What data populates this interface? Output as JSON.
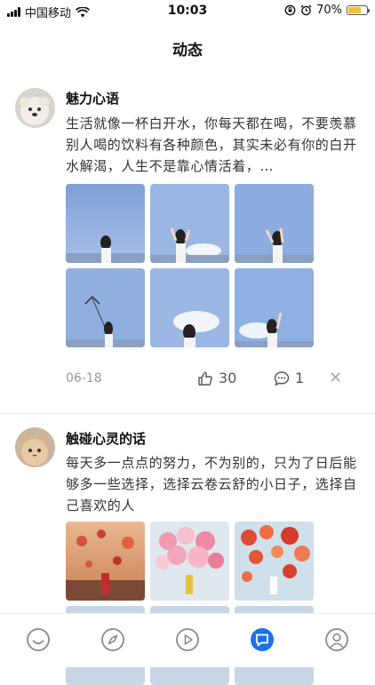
{
  "status_bar": {
    "carrier": "中国移动",
    "time": "10:03",
    "battery": "70%",
    "battery_level": 0.7
  },
  "nav": {
    "title": "动态"
  },
  "posts": [
    {
      "username": "魅力心语",
      "text": "生活就像一杯白开水，你每天都在喝，不要羡慕别人喝的饮料有各种颜色，其实未必有你的白开水解渴，人生不是靠心情活着，…",
      "date": "06-18",
      "likes": "30",
      "comments": "1"
    },
    {
      "username": "触碰心灵的话",
      "text": "每天多一点点的努力，不为别的，只为了日后能够多一些选择，选择云卷云舒的小日子，选择自己喜欢的人"
    }
  ],
  "tabs": [
    {
      "icon": "smile-icon",
      "active": false
    },
    {
      "icon": "compass-icon",
      "active": false
    },
    {
      "icon": "play-icon",
      "active": false
    },
    {
      "icon": "message-icon",
      "active": true
    },
    {
      "icon": "profile-icon",
      "active": false
    }
  ],
  "colors": {
    "accent": "#1a73e8",
    "battery": "#f2c230",
    "text_muted": "#999999"
  }
}
